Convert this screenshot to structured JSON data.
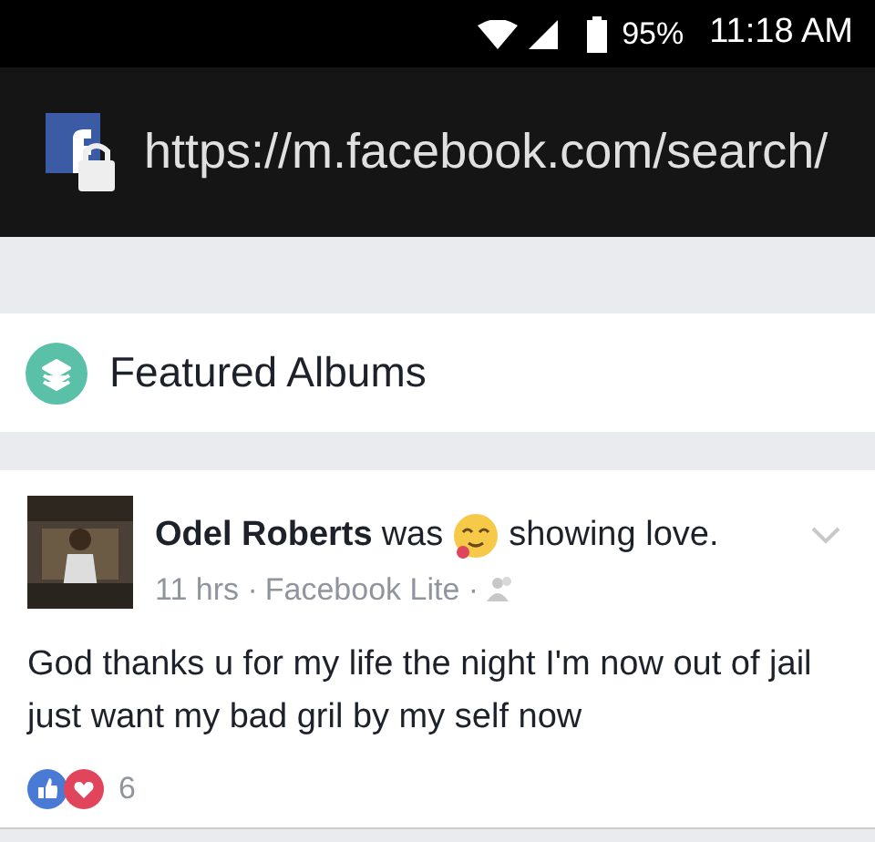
{
  "status_bar": {
    "battery": "95%",
    "time": "11:18 AM"
  },
  "address_bar": {
    "url": "https://m.facebook.com/search/"
  },
  "section": {
    "title": "Featured Albums"
  },
  "post": {
    "author": "Odel Roberts",
    "activity_before": "was",
    "activity_after": "showing love.",
    "time": "11 hrs ·",
    "source": "Facebook Lite ·",
    "text": "God thanks u for my life the night I'm now out of jail just want my bad gril by my self now",
    "reaction_count": "6"
  }
}
